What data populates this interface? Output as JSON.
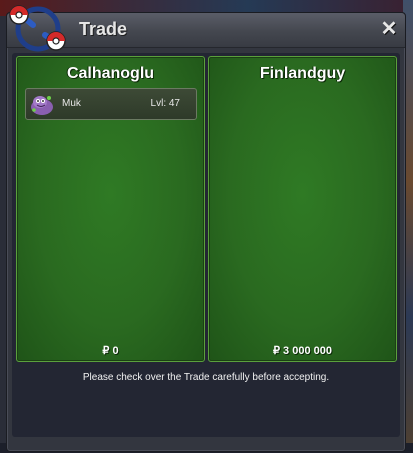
{
  "window": {
    "title": "Trade",
    "close_icon": "close-icon"
  },
  "offers": [
    {
      "player": "Calhanoglu",
      "money": "₽ 0",
      "items": [
        {
          "name": "Muk",
          "level": "Lvl: 47",
          "icon": "muk-icon"
        }
      ]
    },
    {
      "player": "Finlandguy",
      "money": "₽ 3 000 000",
      "items": []
    }
  ],
  "notice": "Please check over the Trade carefully before accepting.",
  "colors": {
    "panel_green": "#2a6a20",
    "panel_border": "#5aa03c",
    "window_bg": "#33363f",
    "content_bg": "#232633"
  }
}
